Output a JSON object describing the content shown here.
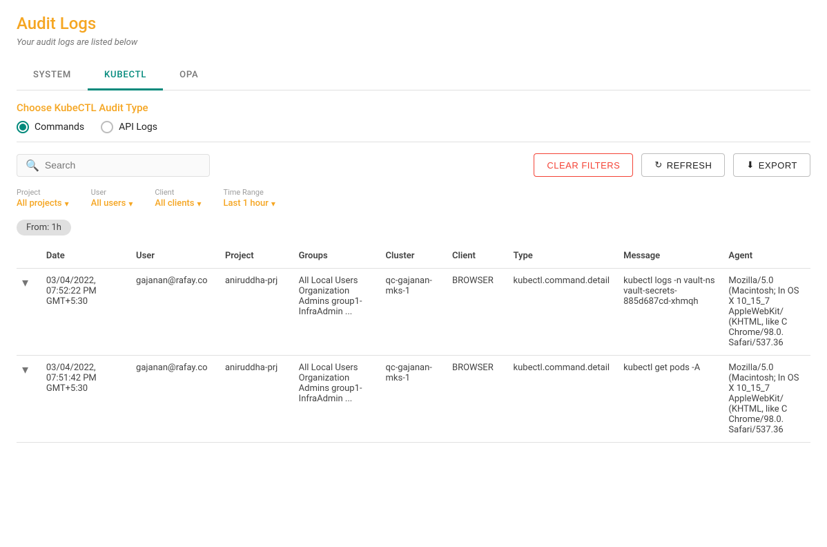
{
  "page": {
    "title": "Audit Logs",
    "subtitle": "Your audit logs are listed below"
  },
  "tabs": [
    {
      "id": "system",
      "label": "SYSTEM",
      "active": false
    },
    {
      "id": "kubectl",
      "label": "KUBECTL",
      "active": true
    },
    {
      "id": "opa",
      "label": "OPA",
      "active": false
    }
  ],
  "kubectl": {
    "title": "Choose KubeCTL Audit Type",
    "options": [
      {
        "id": "commands",
        "label": "Commands",
        "selected": true
      },
      {
        "id": "api-logs",
        "label": "API Logs",
        "selected": false
      }
    ]
  },
  "toolbar": {
    "search_placeholder": "Search",
    "clear_filters_label": "CLEAR FILTERS",
    "refresh_label": "REFRESH",
    "export_label": "EXPORT"
  },
  "filters": {
    "project_label": "Project",
    "project_value": "All projects",
    "user_label": "User",
    "user_value": "All users",
    "client_label": "Client",
    "client_value": "All clients",
    "time_range_label": "Time Range",
    "time_range_value": "Last 1 hour"
  },
  "active_filter_tag": "From: 1h",
  "table": {
    "columns": [
      "",
      "Date",
      "User",
      "Project",
      "Groups",
      "Cluster",
      "Client",
      "Type",
      "Message",
      "Agent"
    ],
    "rows": [
      {
        "expand": "▾",
        "date": "03/04/2022, 07:52:22 PM GMT+5:30",
        "user": "gajanan@rafay.co",
        "project": "aniruddha-prj",
        "groups": "All Local Users Organization Admins group1- InfraAdmin ...",
        "cluster": "qc-gajanan-mks-1",
        "client": "BROWSER",
        "type": "kubectl.command.detail",
        "message": "kubectl logs -n vault-ns vault-secrets-885d687cd-xhmqh",
        "agent": "Mozilla/5.0 (Macintosh; In OS X 10_15_7 AppleWebKit/ (KHTML, like C Chrome/98.0. Safari/537.36"
      },
      {
        "expand": "▾",
        "date": "03/04/2022, 07:51:42 PM GMT+5:30",
        "user": "gajanan@rafay.co",
        "project": "aniruddha-prj",
        "groups": "All Local Users Organization Admins group1- InfraAdmin ...",
        "cluster": "qc-gajanan-mks-1",
        "client": "BROWSER",
        "type": "kubectl.command.detail",
        "message": "kubectl get pods -A",
        "agent": "Mozilla/5.0 (Macintosh; In OS X 10_15_7 AppleWebKit/ (KHTML, like C Chrome/98.0. Safari/537.36"
      }
    ]
  },
  "icons": {
    "search": "🔍",
    "refresh": "↻",
    "export": "⬇",
    "chevron_down": "▾",
    "radio_selected": "●",
    "radio_unselected": "○"
  },
  "colors": {
    "accent_orange": "#f5a623",
    "teal": "#00897b",
    "red": "#f44336",
    "grey_text": "#757575"
  }
}
